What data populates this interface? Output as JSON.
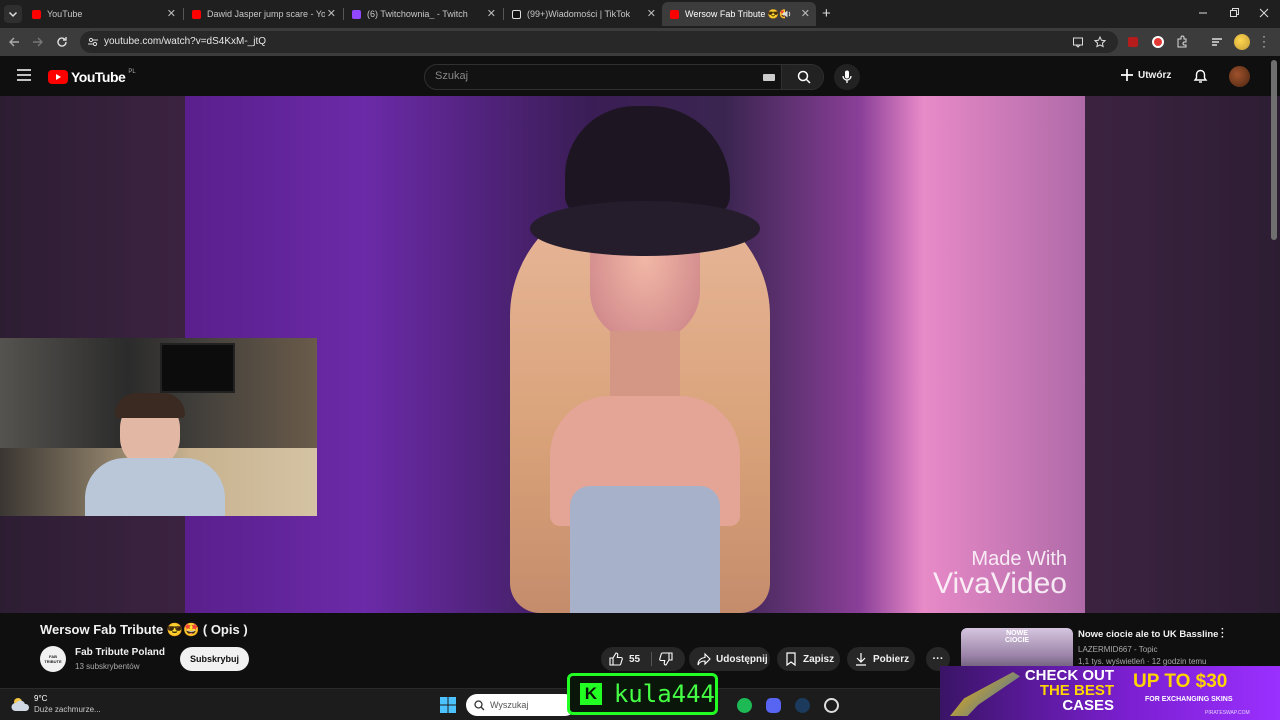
{
  "browser": {
    "tabs": [
      {
        "title": "YouTube",
        "favicon_color": "#ff0000"
      },
      {
        "title": "Dawid Jasper jump scare - YouT",
        "favicon_color": "#ff0000"
      },
      {
        "title": "(6) Twitchownia_ - Twitch",
        "favicon_color": "#9146ff"
      },
      {
        "title": "(99+)Wiadomości | TikTok",
        "favicon_color": "#ffffff"
      },
      {
        "title": "Wersow Fab Tribute 😎🤩",
        "favicon_color": "#ff0000"
      }
    ],
    "url": "youtube.com/watch?v=dS4KxM-_jtQ",
    "new_tab_symbol": "+"
  },
  "youtube": {
    "logo_text": "YouTube",
    "region": "PL",
    "search_placeholder": "Szukaj",
    "create_label": "Utwórz"
  },
  "video": {
    "watermark_line1": "Made With",
    "watermark_line2": "VivaVideo"
  },
  "stream_overlay": {
    "username": "kula444",
    "ad_line1": "CHECK OUT",
    "ad_line2": "THE BEST",
    "ad_line3": "CASES",
    "ad_price": "UP TO $30",
    "ad_sub": "FOR EXCHANGING SKINS",
    "ad_site": "PIRATESWAP.COM"
  },
  "watch": {
    "title": "Wersow Fab Tribute 😎🤩 ( Opis )",
    "channel_name": "Fab Tribute Poland",
    "channel_avatar_text": "FAB TRIBUTE",
    "subscribers": "13 subskrybentów",
    "subscribe_label": "Subskrybuj",
    "likes": "55",
    "share_label": "Udostępnij",
    "save_label": "Zapisz",
    "download_label": "Pobierz",
    "more_symbol": "···"
  },
  "recommended": {
    "title": "Nowe ciocie ale to UK Bassline",
    "channel": "LAZERMID667 - Topic",
    "meta": "1,1 tys. wyświetleń · 12 godzin temu",
    "thumb_text": "NOWE CIOCIE"
  },
  "taskbar": {
    "weather_temp": "9°C",
    "weather_desc": "Duże zachmurze...",
    "search_placeholder": "Wyszukaj"
  },
  "colors": {
    "yt_red": "#ff0000",
    "accent_green": "#22ff22",
    "ad_purple": "#7b1fd1"
  }
}
